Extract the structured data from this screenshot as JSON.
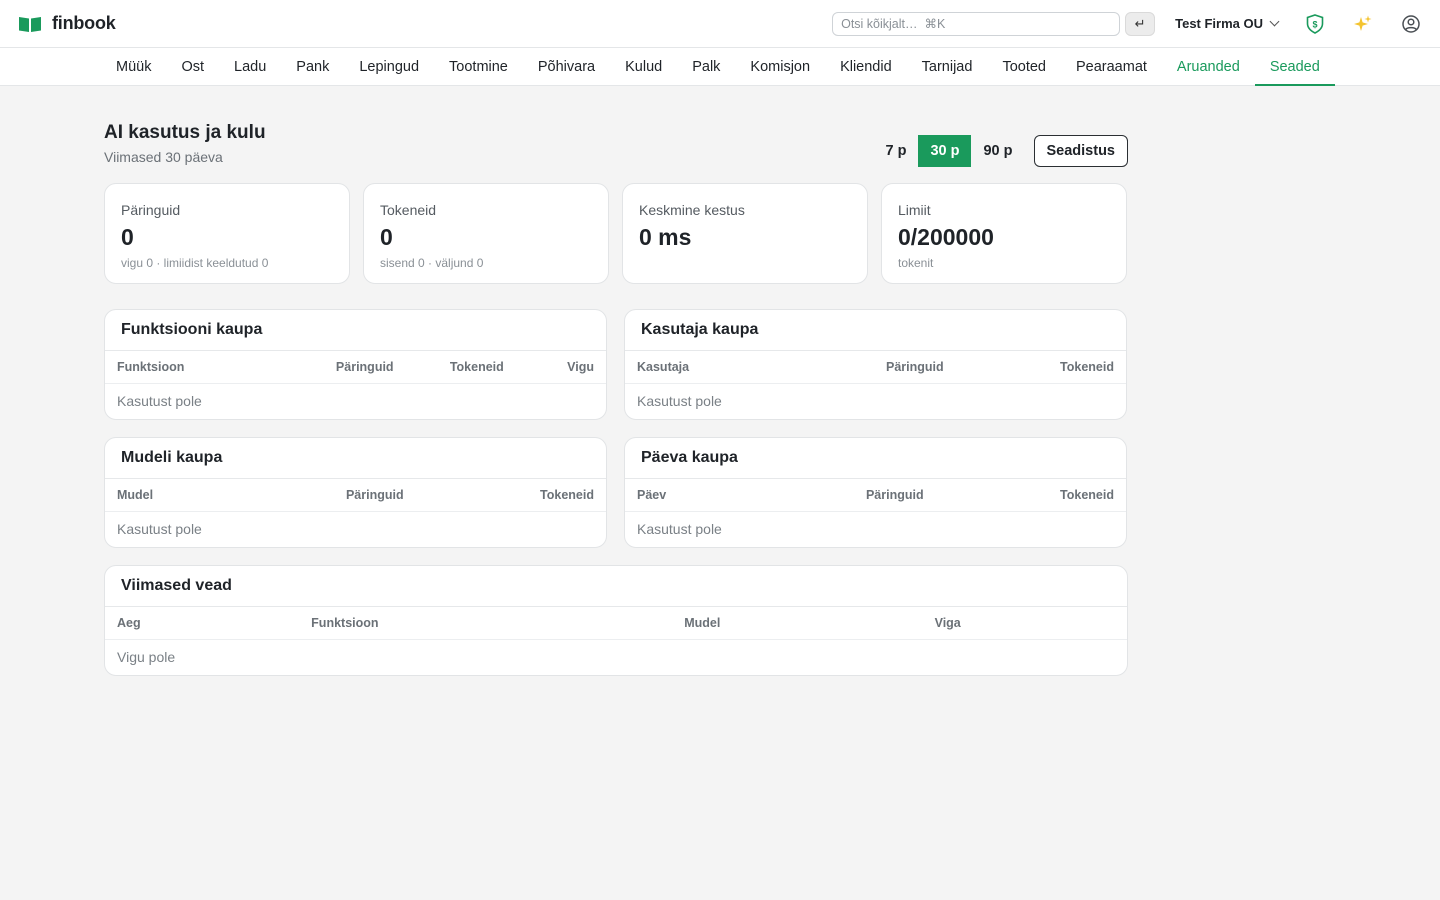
{
  "app": {
    "name": "finbook"
  },
  "header": {
    "search_placeholder": "Otsi kõikjalt…  ⌘K",
    "enter_symbol": "↵",
    "company": "Test Firma OU"
  },
  "nav": {
    "items": [
      {
        "label": "Müük"
      },
      {
        "label": "Ost"
      },
      {
        "label": "Ladu"
      },
      {
        "label": "Pank"
      },
      {
        "label": "Lepingud"
      },
      {
        "label": "Tootmine"
      },
      {
        "label": "Põhivara"
      },
      {
        "label": "Kulud"
      },
      {
        "label": "Palk"
      },
      {
        "label": "Komisjon"
      },
      {
        "label": "Kliendid"
      },
      {
        "label": "Tarnijad"
      },
      {
        "label": "Tooted"
      },
      {
        "label": "Pearaamat"
      },
      {
        "label": "Aruanded"
      },
      {
        "label": "Seaded"
      }
    ],
    "active": "Seaded"
  },
  "page": {
    "title": "AI kasutus ja kulu",
    "subtitle": "Viimased 30 päeva",
    "periods": [
      "7 p",
      "30 p",
      "90 p"
    ],
    "active_period": "30 p",
    "setup_label": "Seadistus"
  },
  "stats": [
    {
      "label": "Päringuid",
      "value": "0",
      "sub": "vigu 0 · limiidist keeldutud 0"
    },
    {
      "label": "Tokeneid",
      "value": "0",
      "sub": "sisend 0 · väljund 0"
    },
    {
      "label": "Keskmine kestus",
      "value": "0 ms",
      "sub": ""
    },
    {
      "label": "Limiit",
      "value": "0/200000",
      "sub": "tokenit"
    }
  ],
  "tables": {
    "by_function": {
      "title": "Funktsiooni kaupa",
      "columns": [
        "Funktsioon",
        "Päringuid",
        "Tokeneid",
        "Vigu"
      ],
      "empty": "Kasutust pole"
    },
    "by_user": {
      "title": "Kasutaja kaupa",
      "columns": [
        "Kasutaja",
        "Päringuid",
        "Tokeneid"
      ],
      "empty": "Kasutust pole"
    },
    "by_model": {
      "title": "Mudeli kaupa",
      "columns": [
        "Mudel",
        "Päringuid",
        "Tokeneid"
      ],
      "empty": "Kasutust pole"
    },
    "by_day": {
      "title": "Päeva kaupa",
      "columns": [
        "Päev",
        "Päringuid",
        "Tokeneid"
      ],
      "empty": "Kasutust pole"
    },
    "recent_errors": {
      "title": "Viimased vead",
      "columns": [
        "Aeg",
        "Funktsioon",
        "Mudel",
        "Viga"
      ],
      "empty": "Vigu pole"
    }
  },
  "colors": {
    "accent": "#1a9a5c",
    "background": "#f4f4f4"
  },
  "icons": {
    "logo": "book-icon",
    "shield": "shield-s-icon",
    "sparkle": "sparkle-icon",
    "user": "user-circle-icon"
  }
}
